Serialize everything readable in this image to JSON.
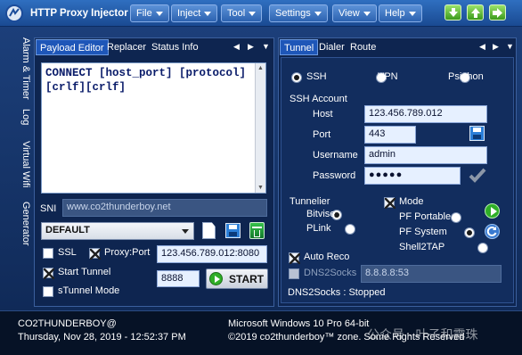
{
  "app": {
    "title": "HTTP Proxy Injector"
  },
  "menus": [
    "File",
    "Inject",
    "Tool",
    "Settings",
    "View",
    "Help"
  ],
  "side_tabs": [
    "Alarm & Timer",
    "Log",
    "Virtual Wifi",
    "Generator"
  ],
  "left_tabs": [
    "Payload Editor",
    "Replacer",
    "Status Info"
  ],
  "payload": {
    "text": "CONNECT [host_port] [protocol][crlf][crlf]"
  },
  "sni": {
    "label": "SNI",
    "value": "www.co2thunderboy.net"
  },
  "profile": {
    "selected": "DEFAULT"
  },
  "options": {
    "ssl_label": "SSL",
    "proxy_port_label": "Proxy:Port",
    "proxy_port_value": "123.456.789.012:8080",
    "start_tunnel_label": "Start Tunnel",
    "local_port_value": "8888",
    "stunnel_label": "sTunnel Mode",
    "start_button": "START",
    "ssl_checked": false,
    "proxy_checked": true,
    "start_tunnel_checked": true,
    "stunnel_checked": false
  },
  "right_tabs": [
    "Tunnel",
    "Dialer",
    "Route"
  ],
  "tunnel_types": {
    "ssh": "SSH",
    "vpn": "VPN",
    "psiphon": "Psiphon",
    "selected": "SSH"
  },
  "ssh_account": {
    "heading": "SSH Account",
    "host_label": "Host",
    "host_value": "123.456.789.012",
    "port_label": "Port",
    "port_value": "443",
    "username_label": "Username",
    "username_value": "admin",
    "password_label": "Password",
    "password_value": "●●●●●"
  },
  "tunnelier": {
    "heading": "Tunnelier",
    "bitvise": "Bitvise",
    "plink": "PLink",
    "selected": "Bitvise"
  },
  "mode": {
    "heading": "Mode",
    "pf_portable": "PF Portable",
    "pf_system": "PF System",
    "shell2tap": "Shell2TAP",
    "selected": "PF System"
  },
  "reconnect": {
    "auto_reco": "Auto Reco",
    "auto_reco_checked": true,
    "dns2socks": "DNS2Socks",
    "dns2socks_checked": false,
    "dns_value": "8.8.8.8:53",
    "dns_status": "DNS2Socks : Stopped"
  },
  "status_bar": {
    "user": "CO2THUNDERBOY@",
    "datetime": "Thursday, Nov 28, 2019 - 12:52:37 PM",
    "os": "Microsoft Windows 10 Pro 64-bit",
    "copyright": "©2019 co2thunderboy™ zone. Some Rights Reserved"
  },
  "watermark": "公众号 · 叶子和露珠",
  "colors": {
    "accent": "#1e56b8",
    "titlebar": "#2f6fc0",
    "panel": "#0e2550"
  },
  "icons": [
    "app-logo-icon",
    "arrow-down-icon",
    "arrow-up-icon",
    "arrow-right-icon",
    "new-file-icon",
    "save-icon",
    "delete-icon",
    "save-account-icon",
    "confirm-check-icon",
    "play-icon",
    "refresh-icon"
  ]
}
